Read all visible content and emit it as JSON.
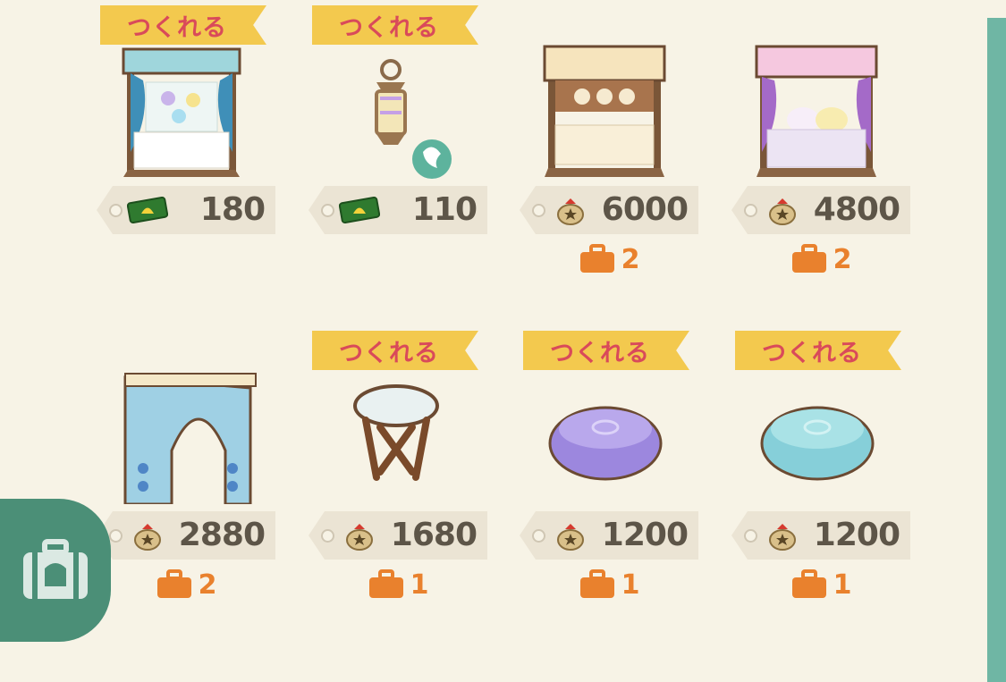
{
  "items": [
    {
      "badge": "つくれる",
      "price": "180",
      "currency": "ticket-icon",
      "capacity": "",
      "art": "stall-blue"
    },
    {
      "badge": "つくれる",
      "price": "110",
      "currency": "ticket-icon",
      "capacity": "",
      "art": "lantern"
    },
    {
      "badge": "",
      "price": "6000",
      "currency": "bell-bag-icon",
      "capacity": "2",
      "art": "stall-tan"
    },
    {
      "badge": "",
      "price": "4800",
      "currency": "bell-bag-icon",
      "capacity": "2",
      "art": "stall-pink"
    },
    {
      "badge": "",
      "price": "2880",
      "currency": "bell-bag-icon",
      "capacity": "2",
      "art": "arch"
    },
    {
      "badge": "つくれる",
      "price": "1680",
      "currency": "bell-bag-icon",
      "capacity": "1",
      "art": "table"
    },
    {
      "badge": "つくれる",
      "price": "1200",
      "currency": "bell-bag-icon",
      "capacity": "1",
      "art": "pouf-purple"
    },
    {
      "badge": "つくれる",
      "price": "1200",
      "currency": "bell-bag-icon",
      "capacity": "1",
      "art": "pouf-blue"
    }
  ],
  "colors": {
    "background": "#f7f3e6",
    "ribbon": "#f3c94e",
    "ribbon_text": "#d94a5a",
    "tag": "#ebe4d4",
    "price_text": "#5d5548",
    "capacity": "#e9812d",
    "accent": "#4b8f77",
    "scrollbar": "#6fb6a4"
  }
}
